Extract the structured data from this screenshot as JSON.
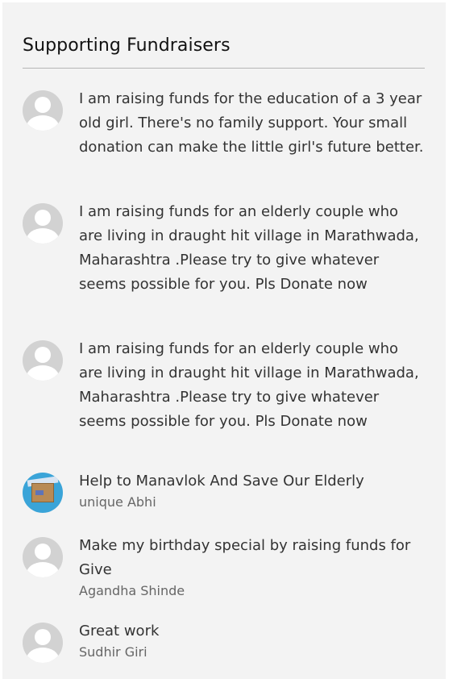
{
  "panel": {
    "title": "Supporting Fundraisers"
  },
  "fundraisers": [
    {
      "avatar": "default-user-icon",
      "text": "I am raising funds for the education of a 3 year old girl. There's no family support. Your small donation can make the little girl's future better.",
      "author": ""
    },
    {
      "avatar": "default-user-icon",
      "text": "I am raising funds for an elderly couple who are living in draught hit village in Marathwada, Maharashtra .Please try to give whatever seems possible for you. Pls Donate now",
      "author": ""
    },
    {
      "avatar": "default-user-icon",
      "text": "I am raising funds for an elderly couple who are living in draught hit village in Marathwada, Maharashtra .Please try to give whatever seems possible for you. Pls Donate now",
      "author": ""
    },
    {
      "avatar": "donation-box-photo",
      "text": "Help to Manavlok And Save Our Elderly",
      "author": "unique Abhi"
    },
    {
      "avatar": "default-user-icon",
      "text": "Make my birthday special by raising funds for Give",
      "author": "Agandha Shinde"
    },
    {
      "avatar": "default-user-icon",
      "text": "Great work",
      "author": "Sudhir Giri"
    }
  ]
}
